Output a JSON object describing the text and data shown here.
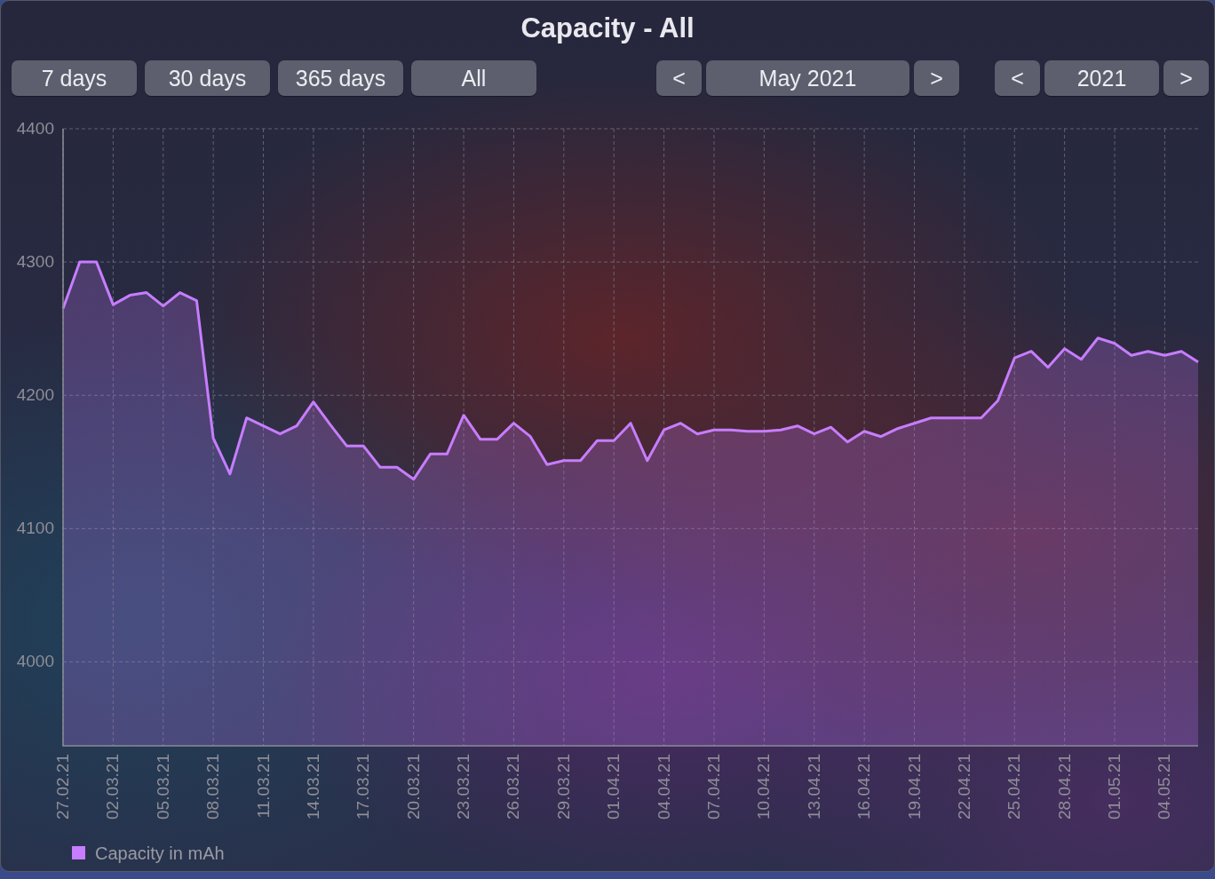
{
  "window": {
    "title": "Capacity - All"
  },
  "range_buttons": [
    {
      "label": "7 days"
    },
    {
      "label": "30 days"
    },
    {
      "label": "365 days"
    },
    {
      "label": "All"
    }
  ],
  "month_nav": {
    "prev": "<",
    "label": "May 2021",
    "next": ">"
  },
  "year_nav": {
    "prev": "<",
    "label": "2021",
    "next": ">"
  },
  "chart": {
    "chart_data": {
      "type": "area",
      "categories": [
        "27.02.21",
        null,
        null,
        "02.03.21",
        null,
        null,
        "05.03.21",
        null,
        null,
        "08.03.21",
        null,
        null,
        "11.03.21",
        null,
        null,
        "14.03.21",
        null,
        null,
        "17.03.21",
        null,
        null,
        "20.03.21",
        null,
        null,
        "23.03.21",
        null,
        null,
        "26.03.21",
        null,
        null,
        "29.03.21",
        null,
        null,
        "01.04.21",
        null,
        null,
        "04.04.21",
        null,
        null,
        "07.04.21",
        null,
        null,
        "10.04.21",
        null,
        null,
        "13.04.21",
        null,
        null,
        "16.04.21",
        null,
        null,
        "19.04.21",
        null,
        null,
        "22.04.21",
        null,
        null,
        "25.04.21",
        null,
        null,
        "28.04.21",
        null,
        null,
        "01.05.21",
        null,
        null,
        "04.05.21",
        null,
        null
      ],
      "series": [
        {
          "name": "Capacity in mAh",
          "color": "#c77dff",
          "values": [
            4265,
            4300,
            4300,
            4268,
            4275,
            4277,
            4267,
            4277,
            4271,
            4168,
            4141,
            4183,
            4177,
            4171,
            4177,
            4195,
            4178,
            4162,
            4162,
            4146,
            4146,
            4137,
            4156,
            4156,
            4185,
            4167,
            4167,
            4179,
            4169,
            4148,
            4151,
            4151,
            4166,
            4166,
            4179,
            4151,
            4174,
            4179,
            4171,
            4174,
            4174,
            4173,
            4173,
            4174,
            4177,
            4171,
            4176,
            4165,
            4173,
            4169,
            4175,
            4179,
            4183,
            4183,
            4183,
            4183,
            4196,
            4228,
            4233,
            4221,
            4235,
            4227,
            4243,
            4239,
            4230,
            4233,
            4230,
            4233,
            4225
          ]
        }
      ],
      "grid": true,
      "ylim": [
        3937,
        4400
      ],
      "yticks": [
        4000,
        4100,
        4200,
        4300,
        4400
      ]
    }
  }
}
